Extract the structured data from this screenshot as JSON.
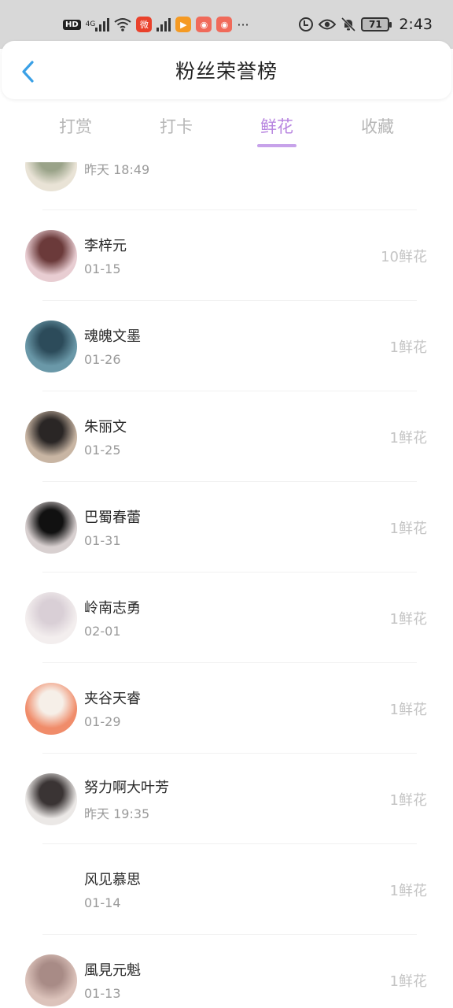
{
  "status_bar": {
    "hd": "HD",
    "network": "4G",
    "battery": "71",
    "time": "2:43",
    "more": "···"
  },
  "header": {
    "title": "粉丝荣誉榜"
  },
  "tabs": [
    {
      "label": "打赏",
      "active": false
    },
    {
      "label": "打卡",
      "active": false
    },
    {
      "label": "鲜花",
      "active": true
    },
    {
      "label": "收藏",
      "active": false
    }
  ],
  "list": [
    {
      "name": "",
      "date": "昨天 18:49",
      "amount": "",
      "avatar_colors": [
        "#e9e3d6",
        "#9aa389"
      ]
    },
    {
      "name": "李梓元",
      "date": "01-15",
      "amount": "10鲜花",
      "avatar_colors": [
        "#e8cdd2",
        "#6b3a3a"
      ]
    },
    {
      "name": "魂魄文墨",
      "date": "01-26",
      "amount": "1鲜花",
      "avatar_colors": [
        "#6a98a8",
        "#2c4b5a"
      ]
    },
    {
      "name": "朱丽文",
      "date": "01-25",
      "amount": "1鲜花",
      "avatar_colors": [
        "#c8b5a3",
        "#2a2625"
      ]
    },
    {
      "name": "巴蜀春蕾",
      "date": "01-31",
      "amount": "1鲜花",
      "avatar_colors": [
        "#d8d0d0",
        "#111111"
      ]
    },
    {
      "name": "岭南志勇",
      "date": "02-01",
      "amount": "1鲜花",
      "avatar_colors": [
        "#f3eeee",
        "#d9cfd6"
      ]
    },
    {
      "name": "夹谷天睿",
      "date": "01-29",
      "amount": "1鲜花",
      "avatar_colors": [
        "#f08c6a",
        "#f6efe8"
      ]
    },
    {
      "name": "努力啊大叶芳",
      "date": "昨天 19:35",
      "amount": "1鲜花",
      "avatar_colors": [
        "#ebe8e6",
        "#3a3434"
      ]
    },
    {
      "name": "风见慕思",
      "date": "01-14",
      "amount": "1鲜花",
      "avatar_colors": []
    },
    {
      "name": "風見元魁",
      "date": "01-13",
      "amount": "1鲜花",
      "avatar_colors": [
        "#dcc3bb",
        "#a88b86"
      ]
    }
  ]
}
